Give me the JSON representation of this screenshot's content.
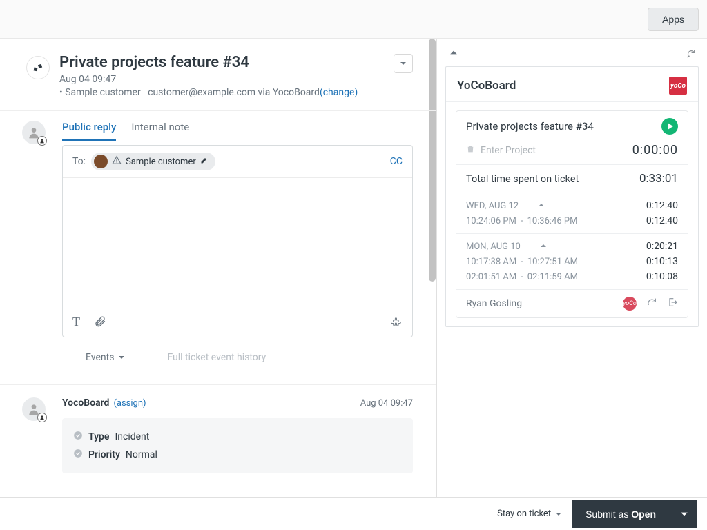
{
  "topbar": {
    "apps": "Apps"
  },
  "ticket": {
    "title": "Private projects feature #34",
    "timestamp": "Aug 04 09:47",
    "customer_prefix": "• Sample customer",
    "customer_email": "customer@example.com via YocoBoard",
    "change_label": "(change)"
  },
  "reply": {
    "tabs": {
      "public": "Public reply",
      "internal": "Internal note"
    },
    "to_label": "To:",
    "recipient": "Sample customer",
    "cc": "CC"
  },
  "events": {
    "label": "Events",
    "history": "Full ticket event history"
  },
  "comment": {
    "author": "YocoBoard",
    "assign": "(assign)",
    "time": "Aug 04 09:47",
    "type_label": "Type",
    "type_value": "Incident",
    "priority_label": "Priority",
    "priority_value": "Normal"
  },
  "panel": {
    "title": "YoCoBoard",
    "logo_text": "yoCo",
    "task_title": "Private projects feature #34",
    "project_placeholder": "Enter Project",
    "timer": "0:00:00",
    "total_label": "Total time spent on ticket",
    "total_value": "0:33:01",
    "days": [
      {
        "label": "WED, AUG 12",
        "total": "0:12:40",
        "entries": [
          {
            "start": "10:24:06 PM",
            "end": "10:36:46 PM",
            "dur": "0:12:40"
          }
        ]
      },
      {
        "label": "MON, AUG 10",
        "total": "0:20:21",
        "entries": [
          {
            "start": "10:17:38 AM",
            "end": "10:27:51 AM",
            "dur": "0:10:13"
          },
          {
            "start": "02:01:51 AM",
            "end": "02:11:59 AM",
            "dur": "0:10:08"
          }
        ]
      }
    ],
    "user": "Ryan Gosling",
    "small_logo": "yoCo"
  },
  "footer": {
    "stay": "Stay on ticket",
    "submit_prefix": "Submit as ",
    "submit_status": "Open"
  }
}
